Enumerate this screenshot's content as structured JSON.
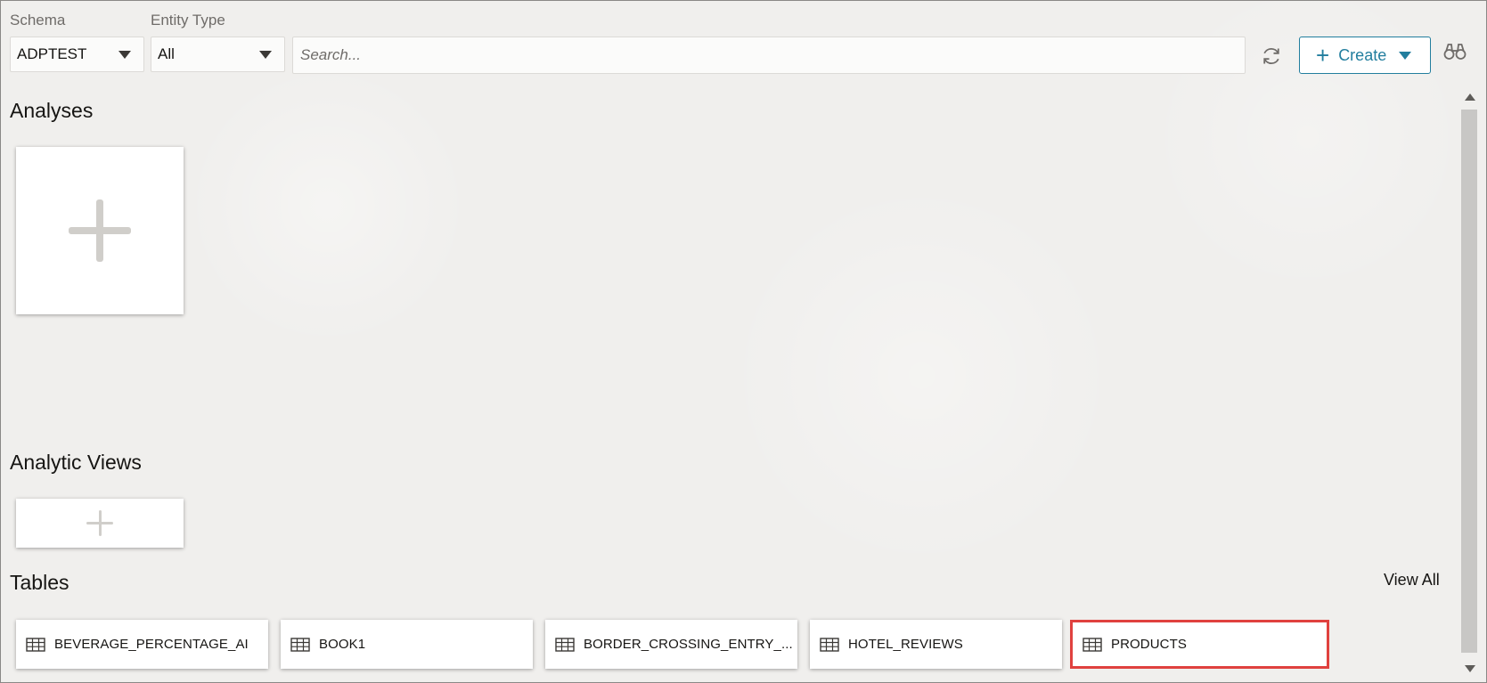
{
  "filters": {
    "schema_label": "Schema",
    "schema_value": "ADPTEST",
    "entity_type_label": "Entity Type",
    "entity_type_value": "All",
    "search_placeholder": "Search..."
  },
  "toolbar": {
    "refresh_icon": "refresh-icon",
    "create_label": "Create",
    "binoculars_icon": "binoculars-icon"
  },
  "sections": {
    "analyses_title": "Analyses",
    "analytic_views_title": "Analytic Views",
    "tables_title": "Tables",
    "view_all_label": "View All"
  },
  "tables": [
    {
      "name": "BEVERAGE_PERCENTAGE_AI",
      "selected": false
    },
    {
      "name": "BOOK1",
      "selected": false
    },
    {
      "name": "BORDER_CROSSING_ENTRY_...",
      "selected": false
    },
    {
      "name": "HOTEL_REVIEWS",
      "selected": false
    },
    {
      "name": "PRODUCTS",
      "selected": true
    }
  ],
  "colors": {
    "accent": "#227e9e",
    "selection_outline": "#e0413e",
    "background": "#f0efed"
  }
}
